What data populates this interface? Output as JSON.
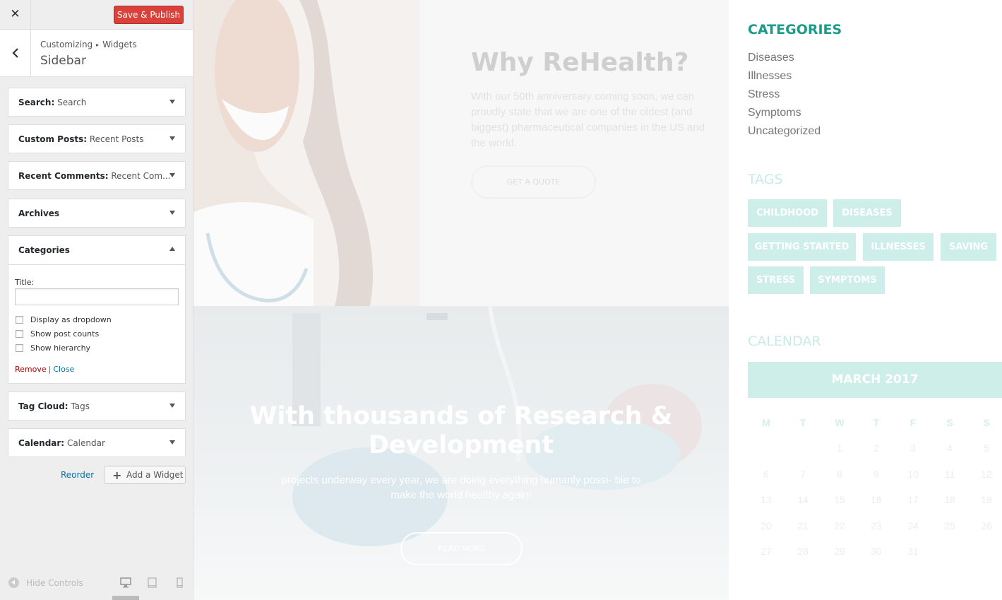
{
  "topbar": {
    "close_icon": "close-icon",
    "publish_label": "Save & Publish",
    "publish_color": "#d9413a"
  },
  "section": {
    "breadcrumb_root": "Customizing",
    "breadcrumb_child": "Widgets",
    "title": "Sidebar"
  },
  "widgets": [
    {
      "name": "Search:",
      "sub": "Search"
    },
    {
      "name": "Custom Posts:",
      "sub": "Recent Posts"
    },
    {
      "name": "Recent Comments:",
      "sub": "Recent Com..."
    },
    {
      "name": "Archives",
      "sub": ""
    },
    {
      "name": "Categories",
      "sub": ""
    },
    {
      "name": "Tag Cloud:",
      "sub": "Tags"
    },
    {
      "name": "Calendar:",
      "sub": "Calendar"
    }
  ],
  "categories_form": {
    "title_label": "Title:",
    "title_value": "",
    "dropdown_label": "Display as dropdown",
    "counts_label": "Show post counts",
    "hierarchy_label": "Show hierarchy",
    "remove_label": "Remove",
    "separator": "|",
    "close_label": "Close"
  },
  "actions": {
    "reorder_label": "Reorder",
    "add_widget_label": "Add a Widget"
  },
  "footer": {
    "hide_controls_label": "Hide Controls",
    "devices": [
      "desktop-icon",
      "tablet-icon",
      "mobile-icon"
    ]
  },
  "preview": {
    "why_title": "Why ReHealth?",
    "why_text": "With our 50th anniversary coming soon, we can proudly state that we are one of the oldest (and biggest) pharmaceutical companies in the US and the world.",
    "quote_label": "GET A QUOTE",
    "research_title": "With thousands of Research & Development",
    "research_text": "projects underway every year, we are doing everything humanly possi- ble to make the world healthy again!",
    "read_more_label": "READ MORE"
  },
  "sidebar": {
    "categories_heading": "CATEGORIES",
    "categories": [
      "Diseases",
      "Illnesses",
      "Stress",
      "Symptoms",
      "Uncategorized"
    ],
    "tags_heading": "TAGS",
    "tags": [
      "CHILDHOOD",
      "DISEASES",
      "GETTING STARTED",
      "ILLNESSES",
      "SAVING",
      "STRESS",
      "SYMPTOMS"
    ],
    "calendar_heading": "CALENDAR",
    "calendar_month": "MARCH 2017",
    "weekdays": [
      "M",
      "T",
      "W",
      "T",
      "F",
      "S",
      "S"
    ],
    "days": [
      "1",
      "2",
      "3",
      "4",
      "5",
      "6",
      "7",
      "8",
      "9",
      "10",
      "11",
      "12",
      "13",
      "14",
      "15",
      "16",
      "17",
      "18",
      "19",
      "20",
      "21",
      "22",
      "23",
      "24",
      "25",
      "26",
      "27",
      "28",
      "29",
      "30",
      "31"
    ]
  },
  "colors": {
    "accent_teal": "#1a9c8a",
    "tag_bg": "#cdeee9",
    "link_blue": "#0073aa",
    "remove_red": "#a00000"
  }
}
